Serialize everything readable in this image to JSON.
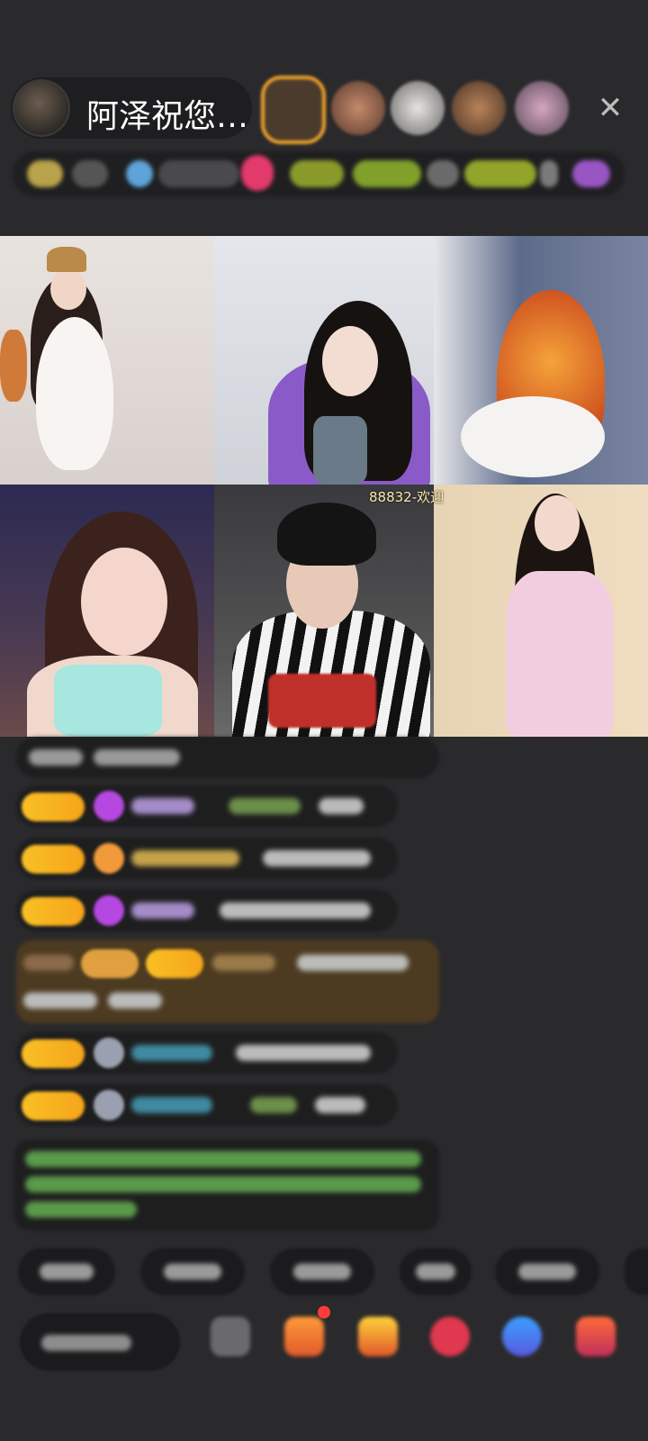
{
  "header": {
    "host_name": "阿泽祝您…",
    "close_glyph": "✕"
  },
  "video": {
    "overlay_text": "88832-欢迎"
  },
  "colors": {
    "badge_gold": "#f7b21f",
    "accent_purple": "#b03bd6",
    "bg": "#2a2a2c"
  },
  "icons": [
    "close-icon",
    "gift-icon",
    "emoji-icon",
    "fan-icon",
    "game-icon",
    "more-icon"
  ]
}
